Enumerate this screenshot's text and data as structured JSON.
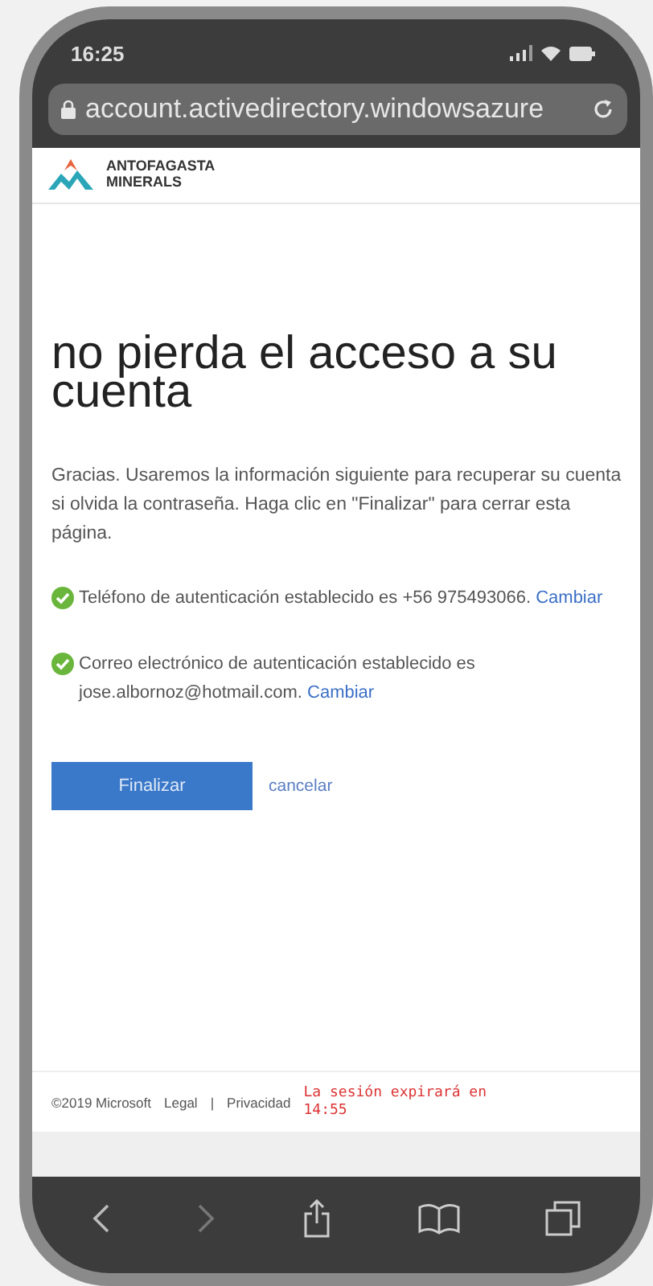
{
  "status_bar": {
    "time": "16:25"
  },
  "address_bar": {
    "url": "account.activedirectory.windowsazure"
  },
  "brand": {
    "line_1": "ANTOFAGASTA",
    "line_2": "MINERALS"
  },
  "heading": "no pierda el acceso a su cuenta",
  "intro": "Gracias. Usaremos la información siguiente para recuperar su cuenta si olvida la contraseña. Haga clic en \"Finalizar\" para cerrar esta página.",
  "confirmations": [
    {
      "text": "Teléfono de autenticación establecido es +56 975493066.",
      "link": "Cambiar"
    },
    {
      "text": "Correo electrónico de autenticación establecido es jose.albornoz@hotmail.com.",
      "link": "Cambiar"
    }
  ],
  "actions": {
    "primary": "Finalizar",
    "cancel": "cancelar"
  },
  "footer": {
    "copyright": "©2019 Microsoft",
    "links": [
      "Legal",
      "Privacidad"
    ],
    "separator": "|",
    "session": "La sesión expirará en 14:55"
  }
}
